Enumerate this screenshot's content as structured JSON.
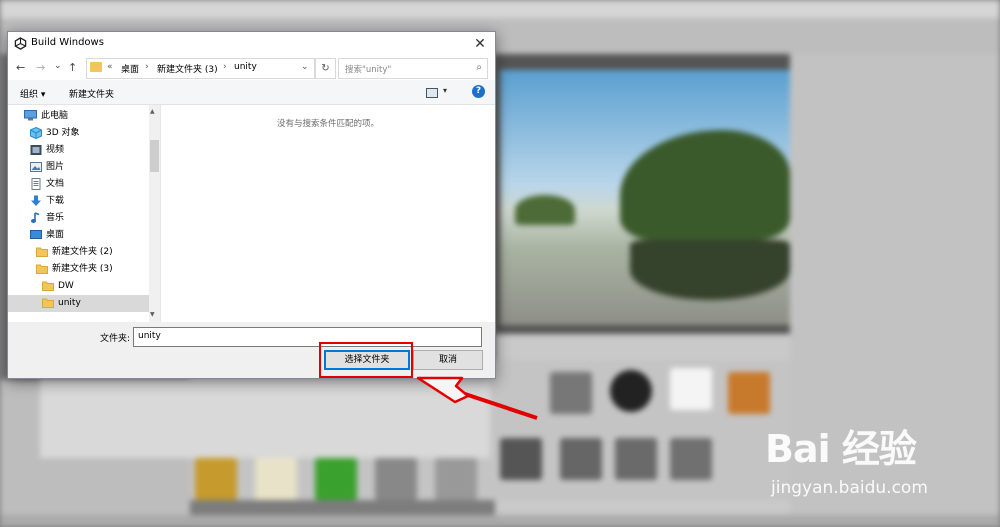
{
  "dialog": {
    "title": "Build Windows",
    "close_glyph": "✕",
    "nav": {
      "back": "←",
      "forward": "→",
      "dropdown": "⌄",
      "up": "↑"
    },
    "breadcrumb": {
      "overflow": "«",
      "items": [
        "桌面",
        "新建文件夹 (3)",
        "unity"
      ],
      "separator": "›"
    },
    "address_dropdown": "⌄",
    "refresh_glyph": "↻",
    "search": {
      "placeholder": "搜索\"unity\"",
      "icon": "⌕"
    },
    "commands": {
      "organize": "组织 ▾",
      "new_folder": "新建文件夹",
      "view_dropdown": "▾",
      "help": "?"
    },
    "tree": [
      {
        "label": "此电脑",
        "icon": "pc-icon",
        "indent": 0
      },
      {
        "label": "3D 对象",
        "icon": "cube-icon",
        "indent": 1
      },
      {
        "label": "视频",
        "icon": "video-icon",
        "indent": 1
      },
      {
        "label": "图片",
        "icon": "picture-icon",
        "indent": 1
      },
      {
        "label": "文档",
        "icon": "document-icon",
        "indent": 1
      },
      {
        "label": "下载",
        "icon": "download-icon",
        "indent": 1
      },
      {
        "label": "音乐",
        "icon": "music-icon",
        "indent": 1
      },
      {
        "label": "桌面",
        "icon": "desktop-icon",
        "indent": 1
      },
      {
        "label": "新建文件夹 (2)",
        "icon": "folder-icon",
        "indent": 2
      },
      {
        "label": "新建文件夹 (3)",
        "icon": "folder-icon",
        "indent": 2
      },
      {
        "label": "DW",
        "icon": "folder-icon",
        "indent": 3
      },
      {
        "label": "unity",
        "icon": "folder-icon",
        "indent": 3,
        "selected": true
      }
    ],
    "empty_message": "没有与搜索条件匹配的项。",
    "folder_label": "文件夹:",
    "folder_value": "unity",
    "select_button": "选择文件夹",
    "cancel_button": "取消"
  },
  "watermark": {
    "brand": "Bai 经验",
    "url": "jingyan.baidu.com"
  },
  "colors": {
    "highlight": "#e30000",
    "accent": "#0078d7",
    "folder": "#f2c55c"
  }
}
